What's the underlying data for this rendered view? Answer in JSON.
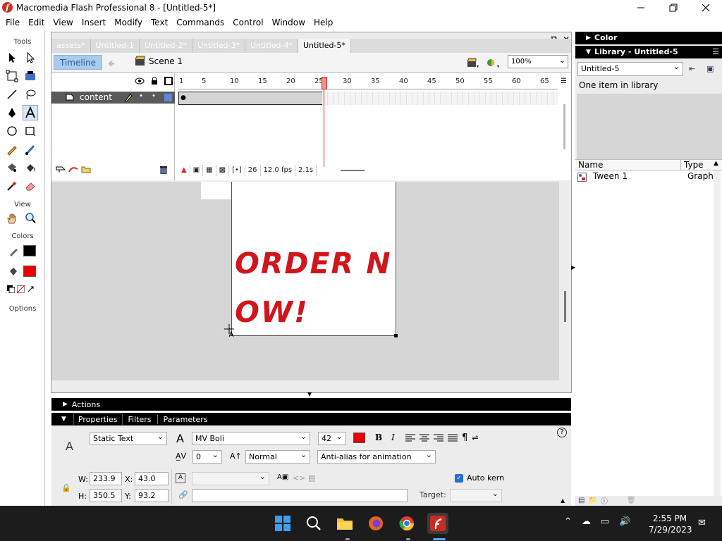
{
  "window": {
    "title": "Macromedia Flash Professional 8 - [Untitled-5*]",
    "app_icon_glyph": "f"
  },
  "menubar": {
    "items": [
      "File",
      "Edit",
      "View",
      "Insert",
      "Modify",
      "Text",
      "Commands",
      "Control",
      "Window",
      "Help"
    ]
  },
  "tools": {
    "header": "Tools",
    "view_header": "View",
    "colors_header": "Colors",
    "options_header": "Options",
    "stroke_color": "#000000",
    "fill_color": "#e60000"
  },
  "documents": {
    "tabs": [
      "assets*",
      "Untitled-1",
      "Untitled-2*",
      "Untitled-3*",
      "Untitled-4*",
      "Untitled-5*"
    ],
    "active_tab": 5
  },
  "editbar": {
    "timeline_label": "Timeline",
    "scene_label": "Scene 1",
    "zoom": "100%"
  },
  "timeline": {
    "layer_name": "content",
    "ruler": [
      "1",
      "5",
      "10",
      "15",
      "20",
      "25",
      "30",
      "35",
      "40",
      "45",
      "50",
      "55",
      "60",
      "65"
    ],
    "current_frame": "26",
    "frame_rate": "12.0 fps",
    "elapsed": "2.1s"
  },
  "stage": {
    "text_line1": "ORDER N",
    "text_line2": "OW!",
    "text_color": "#d0161c"
  },
  "actions": {
    "label": "Actions"
  },
  "properties": {
    "tabs": [
      "Properties",
      "Filters",
      "Parameters"
    ],
    "text_type": "Static Text",
    "font": "MV Boli",
    "font_size": "42",
    "text_color": "#e60000",
    "letter_spacing": "0",
    "char_position": "Normal",
    "antialias": "Anti-alias for animation",
    "auto_kern_label": "Auto kern",
    "auto_kern": true,
    "w_label": "W:",
    "h_label": "H:",
    "x_label": "X:",
    "y_label": "Y:",
    "w": "233.9",
    "h": "350.5",
    "x": "43.0",
    "y": "93.2",
    "target_label": "Target:",
    "help_glyph": "?"
  },
  "right_panels": {
    "color_header": "Color",
    "library_header": "Library - Untitled-5",
    "library_doc": "Untitled-5",
    "library_count": "One item in library",
    "col_name": "Name",
    "col_type": "Type",
    "items": [
      {
        "name": "Tween 1",
        "type": "Graph"
      }
    ]
  },
  "taskbar": {
    "time": "2:55 PM",
    "date": "7/29/2023"
  }
}
